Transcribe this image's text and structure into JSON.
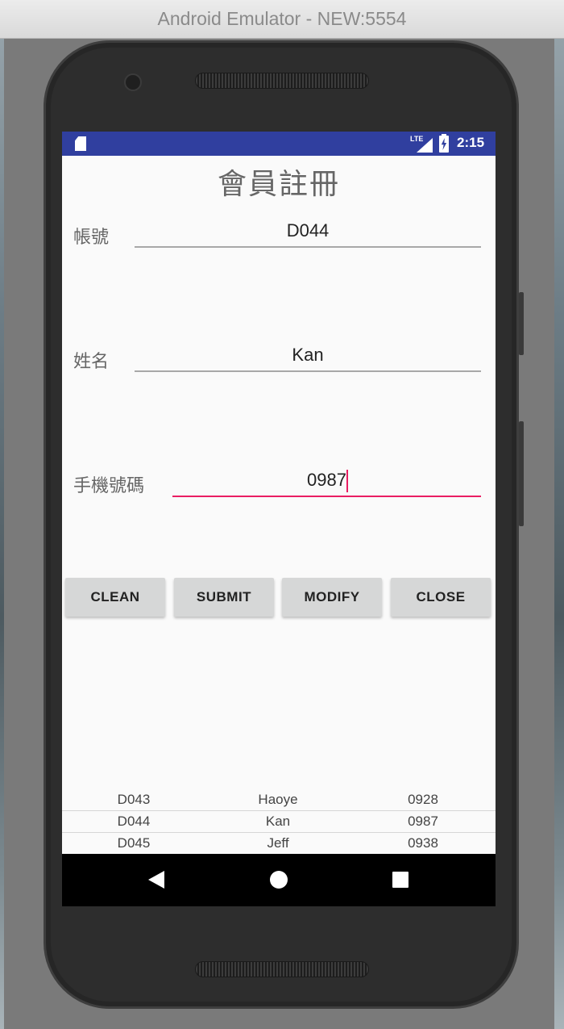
{
  "window": {
    "title": "Android Emulator - NEW:5554"
  },
  "statusbar": {
    "network": "LTE",
    "time": "2:15"
  },
  "form": {
    "title": "會員註冊",
    "account": {
      "label": "帳號",
      "value": "D044"
    },
    "name": {
      "label": "姓名",
      "value": "Kan"
    },
    "phone": {
      "label": "手機號碼",
      "value": "0987"
    }
  },
  "buttons": {
    "clean": "CLEAN",
    "submit": "SUBMIT",
    "modify": "MODIFY",
    "close": "CLOSE"
  },
  "records": [
    {
      "account": "D043",
      "name": "Haoye",
      "phone": "0928"
    },
    {
      "account": "D044",
      "name": "Kan",
      "phone": "0987"
    },
    {
      "account": "D045",
      "name": "Jeff",
      "phone": "0938"
    }
  ],
  "colors": {
    "statusbar": "#303f9f",
    "accent": "#e91e63",
    "button": "#d6d7d7"
  }
}
